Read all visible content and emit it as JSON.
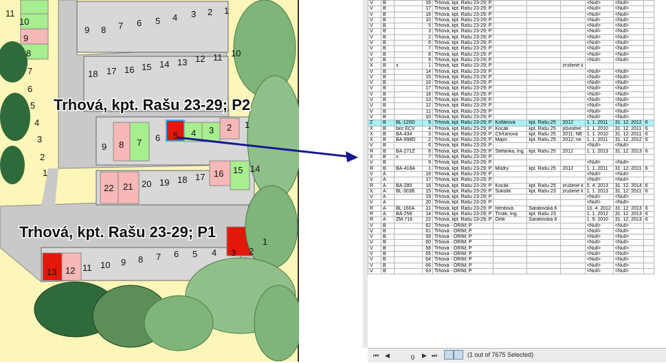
{
  "map": {
    "labels": {
      "p2": "Trhová, kpt. Rašu 23-29; P2",
      "p1": "Trhová, kpt. Rašu 23-29; P1"
    },
    "colors": {
      "free": "#a7ee8f",
      "reserved": "#f7b8b8",
      "selected": "#e3170a",
      "road": "#c9c9c9",
      "ground": "#fdf6b9",
      "tree": "#7fb47a"
    }
  },
  "table": {
    "rows": [
      [
        "V",
        "B",
        "",
        "16",
        "Trhová, kpt. Rašu 23-29; P",
        "",
        "",
        "",
        "<Null>",
        "<Null>",
        ""
      ],
      [
        "V",
        "B",
        "",
        "17",
        "Trhová, kpt. Rašu 23-29; P",
        "",
        "",
        "",
        "<Null>",
        "<Null>",
        ""
      ],
      [
        "V",
        "B",
        "",
        "18",
        "Trhová, kpt. Rašu 23-29; P",
        "",
        "",
        "",
        "<Null>",
        "<Null>",
        ""
      ],
      [
        "V",
        "B",
        "",
        "10",
        "Trhová, kpt. Rašu 23-29; P",
        "",
        "",
        "",
        "<Null>",
        "<Null>",
        ""
      ],
      [
        "V",
        "B",
        "",
        "5",
        "Trhová, kpt. Rašu 23-29; P",
        "",
        "",
        "",
        "<Null>",
        "<Null>",
        ""
      ],
      [
        "V",
        "B",
        "",
        "3",
        "Trhová, kpt. Rašu 23-29; P",
        "",
        "",
        "",
        "<Null>",
        "<Null>",
        ""
      ],
      [
        "V",
        "B",
        "",
        "2",
        "Trhová, kpt. Rašu 23-29; P",
        "",
        "",
        "",
        "<Null>",
        "<Null>",
        ""
      ],
      [
        "V",
        "B",
        "",
        "6",
        "Trhová, kpt. Rašu 23-29; P",
        "",
        "",
        "",
        "<Null>",
        "<Null>",
        ""
      ],
      [
        "V",
        "B",
        "",
        "7",
        "Trhová, kpt. Rašu 23-29; P",
        "",
        "",
        "",
        "<Null>",
        "<Null>",
        ""
      ],
      [
        "V",
        "B",
        "",
        "8",
        "Trhová, kpt. Rašu 23-29; P",
        "",
        "",
        "",
        "<Null>",
        "<Null>",
        ""
      ],
      [
        "V",
        "B",
        "",
        "9",
        "Trhová, kpt. Rašu 23-29; P",
        "",
        "",
        "",
        "<Null>",
        "<Null>",
        ""
      ],
      [
        "X",
        "B",
        "x",
        "1",
        "Trhová, kpt. Rašu 23-29; P",
        "",
        "",
        "zrušené k",
        "",
        "",
        " "
      ],
      [
        "V",
        "B",
        "",
        "14",
        "Trhová, kpt. Rašu 23-29; P",
        "",
        "",
        "",
        "<Null>",
        "<Null>",
        ""
      ],
      [
        "V",
        "B",
        "",
        "15",
        "Trhová, kpt. Rašu 23-29; P",
        "",
        "",
        "",
        "<Null>",
        "<Null>",
        ""
      ],
      [
        "V",
        "B",
        "",
        "16",
        "Trhová, kpt. Rašu 23-29; P",
        "",
        "",
        "",
        "<Null>",
        "<Null>",
        ""
      ],
      [
        "V",
        "B",
        "",
        "17",
        "Trhová, kpt. Rašu 23-29; P",
        "",
        "",
        "",
        "<Null>",
        "<Null>",
        ""
      ],
      [
        "V",
        "B",
        "",
        "18",
        "Trhová, kpt. Rašu 23-29; P",
        "",
        "",
        "",
        "<Null>",
        "<Null>",
        ""
      ],
      [
        "V",
        "B",
        "",
        "13",
        "Trhová, kpt. Rašu 23-29; P",
        "",
        "",
        "",
        "<Null>",
        "<Null>",
        ""
      ],
      [
        "V",
        "B",
        "",
        "12",
        "Trhová, kpt. Rašu 23-29; P",
        "",
        "",
        "",
        "<Null>",
        "<Null>",
        ""
      ],
      [
        "V",
        "B",
        "",
        "11",
        "Trhová, kpt. Rašu 23-29; P",
        "",
        "",
        "",
        "<Null>",
        "<Null>",
        ""
      ],
      [
        "V",
        "B",
        "",
        "10",
        "Trhová, kpt. Rašu 23-29; P",
        "",
        "",
        "",
        "<Null>",
        "<Null>",
        ""
      ],
      [
        "Z",
        "B",
        "BL-120D",
        "5",
        "Trhová, kpt. Rašu 23-29; P",
        "Kollárová",
        "kpt. Rašu 25",
        "2012",
        "1. 1. 2011",
        "31. 12. 2012",
        "6"
      ],
      [
        "X",
        "B",
        "bez EČV",
        "4",
        "Trhová, kpt. Rašu 23-29; P",
        "Kocák",
        "kpt. Rašu 25",
        "pôvodne:",
        "1. 1. 2010",
        "31. 12. 2011",
        "6"
      ],
      [
        "X",
        "B",
        "BA-434",
        "3",
        "Trhová, kpt. Rašu 23-29; P",
        "Chrťanová",
        "kpt. Rašu 25",
        "2011; NE",
        "1. 1. 2010",
        "31. 12. 2011",
        "6"
      ],
      [
        "X",
        "B",
        "BA-998D",
        "2",
        "Trhová, kpt. Rašu 23-29; P",
        "Major",
        "kpt. Rašu 25",
        "2012; ne",
        "1. 1. 2011",
        "31. 12. 2012",
        "6"
      ],
      [
        "V",
        "B",
        "",
        "6",
        "Trhová, kpt. Rašu 23-29; P",
        "",
        "",
        "",
        "<Null>",
        "<Null>",
        ""
      ],
      [
        "R",
        "B",
        "BA-271Z",
        "8",
        "Trhová, kpt. Rašu 23-29; P",
        "Štefanka, Ing.",
        "kpt. Rašu 25",
        "2012",
        "1. 1. 2013",
        "31. 12. 2013",
        "6"
      ],
      [
        "X",
        "B",
        "x",
        "7",
        "Trhová, kpt. Rašu 23-29; P",
        "",
        "",
        "",
        "",
        "",
        " "
      ],
      [
        "V",
        "B",
        "",
        "9",
        "Trhová, kpt. Rašu 23-29; P",
        "",
        "",
        "",
        "<Null>",
        "<Null>",
        ""
      ],
      [
        "R",
        "B",
        "BA-418A",
        "1",
        "Trhová, kpt. Rašu 23-29; P",
        "Můdry",
        "kpt. Rašu 25",
        "2012",
        "1. 1. 2011",
        "31. 12. 2011",
        "6"
      ],
      [
        "V",
        "A",
        "",
        "18",
        "Trhová, kpt. Rašu 23-29; P",
        "",
        "",
        "",
        "<Null>",
        "<Null>",
        ""
      ],
      [
        "V",
        "A",
        "",
        "17",
        "Trhová, kpt. Rašu 23-29; P",
        "",
        "",
        "",
        "<Null>",
        "<Null>",
        ""
      ],
      [
        "R",
        "A",
        "BA-280",
        "16",
        "Trhová, kpt. Rašu 23-29; P",
        "Kocák",
        "kpt. Rašu 25",
        "zrušené k",
        "5. 4. 2013",
        "31. 12. 2014",
        "6"
      ],
      [
        "X",
        "A",
        "BL-303B",
        "15",
        "Trhová, kpt. Rašu 23-29; P",
        "Sokolík",
        "kpt. Rašu 23",
        "zrušené k",
        "1. 1. 2013",
        "31. 12. 2011",
        "6"
      ],
      [
        "V",
        "A",
        "",
        "19",
        "Trhová, kpt. Rašu 23-29; P",
        "",
        "",
        "",
        "<Null>",
        "<Null>",
        ""
      ],
      [
        "V",
        "A",
        "",
        "20",
        "Trhová, kpt. Rašu 23-29; P",
        "",
        "",
        "",
        "<Null>",
        "<Null>",
        ""
      ],
      [
        "R",
        "A",
        "BL-160A",
        "21",
        "Trhová, kpt. Rašu 23-29; P",
        "Herdová",
        "Saratovská 6",
        "",
        "10. 4. 2012",
        "31. 12. 2013",
        "6"
      ],
      [
        "R",
        "A",
        "BA-258",
        "14",
        "Trhová, kpt. Rašu 23-29; P",
        "Trnák, Ing.",
        "kpt. Rašu 23",
        "",
        "1. 1. 2012",
        "31. 12. 2013",
        "6"
      ],
      [
        "R",
        "A",
        "ZM-716",
        "22",
        "Trhová, kpt. Rašu 23-29; P",
        "Orlik",
        "Saratovská 6",
        "",
        "1. 9. 2010",
        "31. 12. 2013",
        "6"
      ],
      [
        "V",
        "B",
        "",
        "62",
        "Trhová - ORIM; P",
        "",
        "",
        "",
        "<Null>",
        "<Null>",
        ""
      ],
      [
        "V",
        "B",
        "",
        "61",
        "Trhová - ORIM; P",
        "",
        "",
        "",
        "<Null>",
        "<Null>",
        ""
      ],
      [
        "V",
        "B",
        "",
        "59",
        "Trhová - ORIM; P",
        "",
        "",
        "",
        "<Null>",
        "<Null>",
        ""
      ],
      [
        "V",
        "B",
        "",
        "60",
        "Trhová - ORIM; P",
        "",
        "",
        "",
        "<Null>",
        "<Null>",
        ""
      ],
      [
        "V",
        "B",
        "",
        "58",
        "Trhová - ORIM; P",
        "",
        "",
        "",
        "<Null>",
        "<Null>",
        ""
      ],
      [
        "V",
        "B",
        "",
        "65",
        "Trhová - ORIM; P",
        "",
        "",
        "",
        "<Null>",
        "<Null>",
        ""
      ],
      [
        "V",
        "B",
        "",
        "64",
        "Trhová - ORIM; P",
        "",
        "",
        "",
        "<Null>",
        "<Null>",
        ""
      ],
      [
        "V",
        "B",
        "",
        "66",
        "Trhová - ORIM; P",
        "",
        "",
        "",
        "<Null>",
        "<Null>",
        ""
      ],
      [
        "V",
        "B",
        "",
        "63",
        "Trhová - ORIM; P",
        "",
        "",
        "",
        "<Null>",
        "<Null>",
        ""
      ]
    ],
    "selected_row": 21
  },
  "status": {
    "record": "0",
    "selection": "(1 out of 7675 Selected)",
    "nav_first": "⏮",
    "nav_prev": "◀",
    "nav_next": "▶",
    "nav_last": "⏭"
  }
}
